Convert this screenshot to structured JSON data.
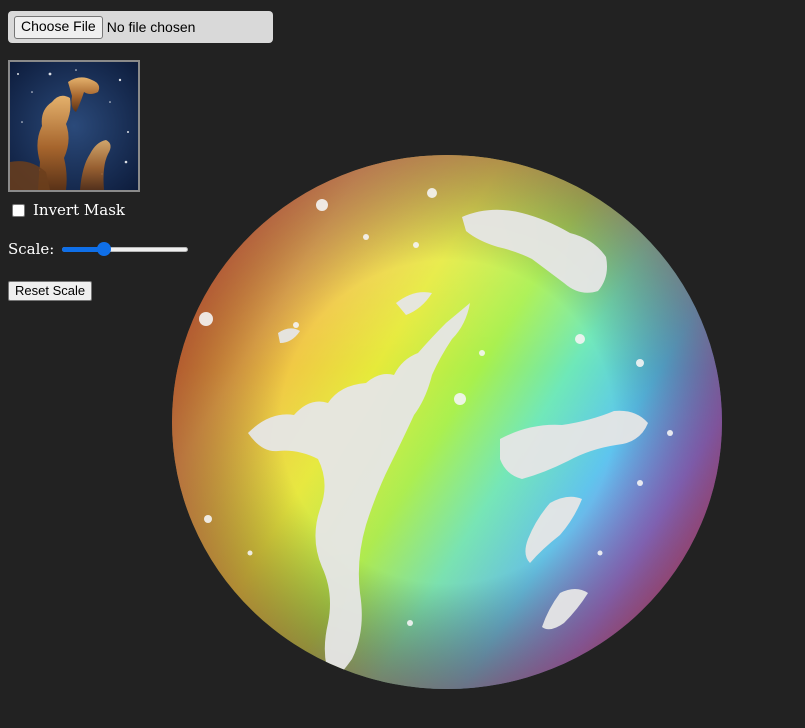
{
  "file_input": {
    "button_label": "Choose File",
    "status": "No file chosen"
  },
  "thumbnail": {
    "image_name": "space-nebula-thumbnail"
  },
  "invert_mask": {
    "label": "Invert Mask",
    "checked": false
  },
  "scale": {
    "label": "Scale:",
    "value_fraction": 0.32
  },
  "reset_button": {
    "label": "Reset Scale"
  },
  "canvas": {
    "image_name": "rainbow-gradient-masked-sphere"
  },
  "colors": {
    "background": "#222222",
    "accent": "#0f6fe8"
  }
}
